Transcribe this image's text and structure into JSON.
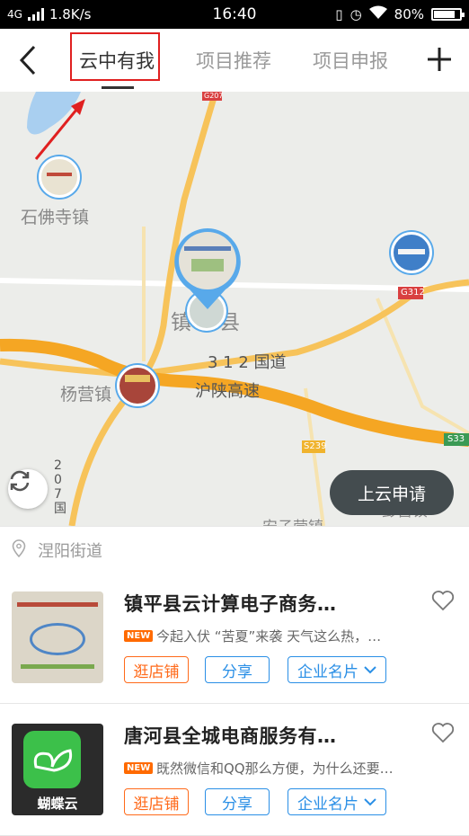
{
  "status_bar": {
    "network": "4G",
    "speed": "1.8K/s",
    "time": "16:40",
    "battery": "80%"
  },
  "nav": {
    "tabs": [
      {
        "label": "云中有我",
        "active": true
      },
      {
        "label": "项目推荐",
        "active": false
      },
      {
        "label": "项目申报",
        "active": false
      }
    ]
  },
  "map": {
    "place_labels": [
      "石佛寺镇",
      "镇",
      "县",
      "杨营镇",
      "安子营镇",
      "彭营镇"
    ],
    "road_labels": [
      "3 1 2 国道",
      "沪陕高速",
      "2 0 7 国"
    ],
    "road_shields": [
      "G207",
      "G312",
      "S239",
      "S33"
    ],
    "apply_button": "上云申请"
  },
  "location": {
    "text": "涅阳街道"
  },
  "items": [
    {
      "title": "镇平县云计算电子商务…",
      "badge": "NEW",
      "snippet": "今起入伏 “苦夏”来袭 天气这么热，…",
      "buttons": {
        "shop": "逛店铺",
        "share": "分享",
        "card": "企业名片"
      }
    },
    {
      "title": "唐河县全城电商服务有…",
      "badge": "NEW",
      "snippet": "既然微信和QQ那么方便，为什么还要…",
      "logo_text": "蝴蝶云",
      "buttons": {
        "shop": "逛店铺",
        "share": "分享",
        "card": "企业名片"
      }
    }
  ],
  "colors": {
    "accent_orange": "#ff6a1a",
    "accent_blue": "#2a8fe6",
    "highlight_red": "#e02020",
    "road_yellow": "#f7b733"
  }
}
